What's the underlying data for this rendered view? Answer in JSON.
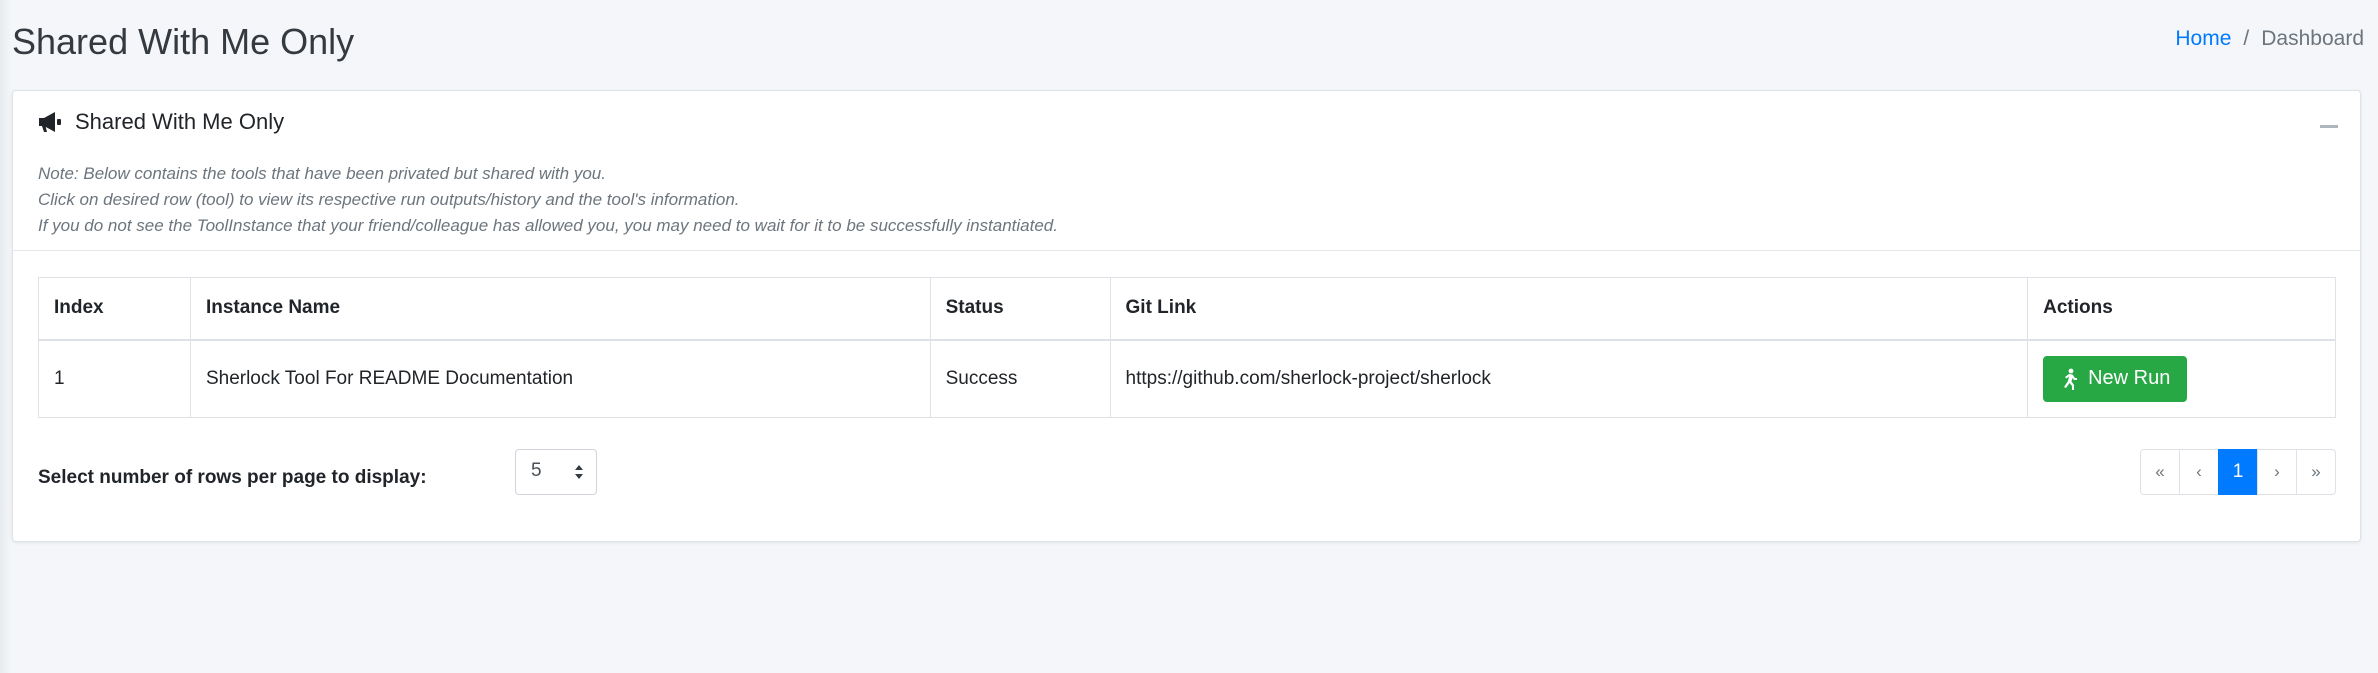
{
  "header": {
    "title": "Shared With Me Only",
    "breadcrumb": {
      "home": "Home",
      "separator": "/",
      "current": "Dashboard"
    }
  },
  "card": {
    "title": "Shared With Me Only",
    "title_icon": "megaphone-icon",
    "collapse_icon": "minus-icon",
    "notes": [
      "Note: Below contains the tools that have been privated but shared with you.",
      "Click on desired row (tool) to view its respective run outputs/history and the tool's information.",
      "If you do not see the ToolInstance that your friend/colleague has allowed you, you may need to wait for it to be successfully instantiated."
    ]
  },
  "table": {
    "columns": [
      "Index",
      "Instance Name",
      "Status",
      "Git Link",
      "Actions"
    ],
    "rows": [
      {
        "index": "1",
        "name": "Sherlock Tool For README Documentation",
        "status": "Success",
        "git_link": "https://github.com/sherlock-project/sherlock",
        "action_label": "New Run",
        "action_icon": "running-icon"
      }
    ]
  },
  "footer": {
    "rows_label": "Select number of rows per page to display:",
    "rows_value": "5",
    "pagination": {
      "first": "«",
      "prev": "‹",
      "current": "1",
      "next": "›",
      "last": "»"
    }
  },
  "colors": {
    "link": "#007bff",
    "success": "#28a745",
    "active_page": "#007bff",
    "background": "#f4f6f9"
  }
}
